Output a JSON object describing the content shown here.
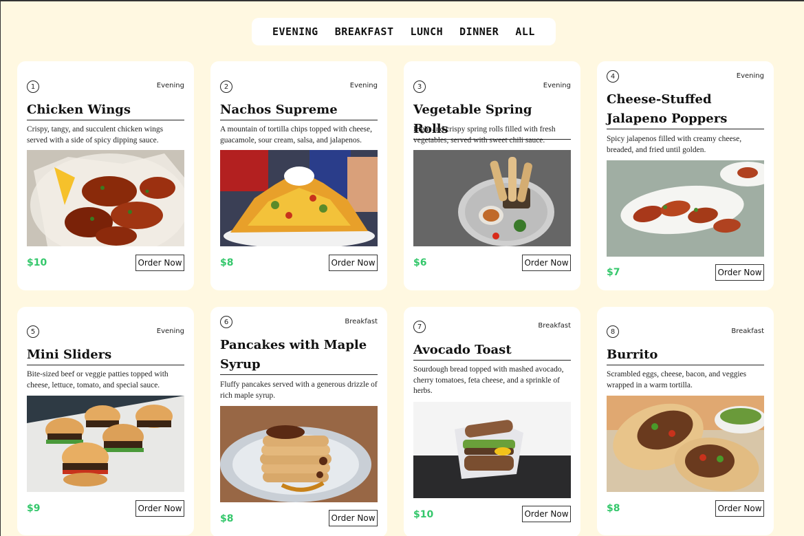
{
  "nav": {
    "items": [
      {
        "label": "EVENING"
      },
      {
        "label": "BREAKFAST"
      },
      {
        "label": "LUNCH"
      },
      {
        "label": "DINNER"
      },
      {
        "label": "ALL"
      }
    ]
  },
  "cards": [
    {
      "number": "1",
      "category": "Evening",
      "title": "Chicken Wings",
      "description": "Crispy, tangy, and succulent chicken wings served with a side of spicy dipping sauce.",
      "price": "$10",
      "button": "Order Now",
      "image": "chicken-wings-photo"
    },
    {
      "number": "2",
      "category": "Evening",
      "title": "Nachos Supreme",
      "description": "A mountain of tortilla chips topped with cheese, guacamole, sour cream, salsa, and jalapenos.",
      "price": "$8",
      "button": "Order Now",
      "image": "nachos-photo"
    },
    {
      "number": "3",
      "category": "Evening",
      "title": "Vegetable Spring Rolls",
      "description": "Light and crispy spring rolls filled with fresh vegetables, served with sweet chili sauce.",
      "price": "$6",
      "button": "Order Now",
      "image": "spring-rolls-photo"
    },
    {
      "number": "4",
      "category": "Evening",
      "title": "Cheese-Stuffed Jalapeno Poppers",
      "description": "Spicy jalapenos filled with creamy cheese, breaded, and fried until golden.",
      "price": "$7",
      "button": "Order Now",
      "image": "jalapeno-poppers-photo"
    },
    {
      "number": "5",
      "category": "Evening",
      "title": "Mini Sliders",
      "description": "Bite-sized beef or veggie patties topped with cheese, lettuce, tomato, and special sauce.",
      "price": "$9",
      "button": "Order Now",
      "image": "sliders-photo"
    },
    {
      "number": "6",
      "category": "Breakfast",
      "title": "Pancakes with Maple Syrup",
      "description": "Fluffy pancakes served with a generous drizzle of rich maple syrup.",
      "price": "$8",
      "button": "Order Now",
      "image": "pancakes-photo"
    },
    {
      "number": "7",
      "category": "Breakfast",
      "title": "Avocado Toast",
      "description": "Sourdough bread topped with mashed avocado, cherry tomatoes, feta cheese, and a sprinkle of herbs.",
      "price": "$10",
      "button": "Order Now",
      "image": "avocado-toast-photo"
    },
    {
      "number": "8",
      "category": "Breakfast",
      "title": "Burrito",
      "description": "Scrambled eggs, cheese, bacon, and veggies wrapped in a warm tortilla.",
      "price": "$8",
      "button": "Order Now",
      "image": "burrito-photo"
    }
  ]
}
